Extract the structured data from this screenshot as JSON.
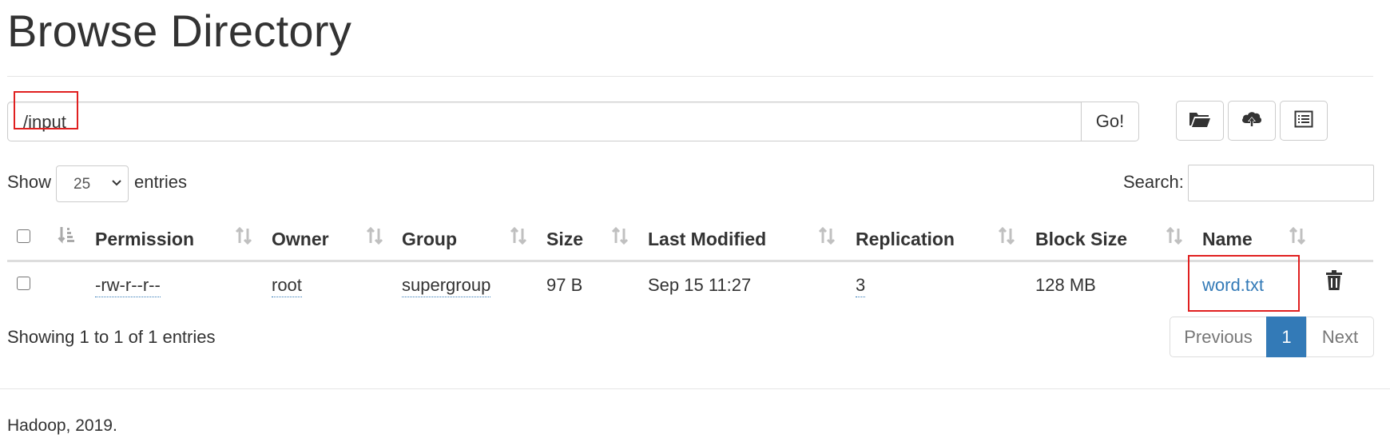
{
  "page_title": "Browse Directory",
  "path_bar": {
    "value": "/input",
    "go_label": "Go!"
  },
  "toolbar": {
    "icons": [
      "folder-open-icon",
      "cloud-upload-icon",
      "list-alt-icon"
    ]
  },
  "table_controls": {
    "show_label": "Show",
    "page_length": "25",
    "entries_label": "entries",
    "search_label": "Search:",
    "search_value": ""
  },
  "table": {
    "columns": [
      "Permission",
      "Owner",
      "Group",
      "Size",
      "Last Modified",
      "Replication",
      "Block Size",
      "Name"
    ],
    "rows": [
      {
        "permission": "-rw-r--r--",
        "owner": "root",
        "group": "supergroup",
        "size": "97 B",
        "last_modified": "Sep 15 11:27",
        "replication": "3",
        "block_size": "128 MB",
        "name": "word.txt"
      }
    ]
  },
  "info": {
    "text": "Showing 1 to 1 of 1 entries"
  },
  "pagination": {
    "previous": "Previous",
    "current": "1",
    "next": "Next"
  },
  "footer": {
    "text": "Hadoop, 2019."
  },
  "colors": {
    "link": "#337ab7",
    "highlight_box": "#e02020",
    "active_page": "#337ab7"
  }
}
